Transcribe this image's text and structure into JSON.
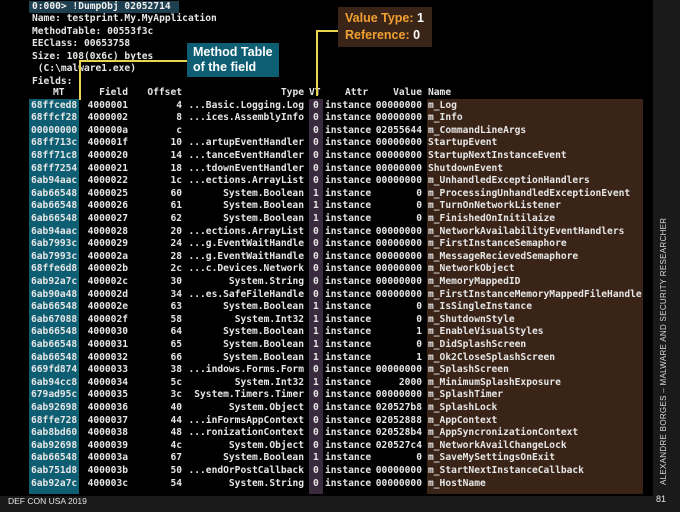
{
  "header": {
    "command": "0:000> !DumpObj 02052714",
    "name": "Name: testprint.My.MyApplication",
    "method_table": "MethodTable: 00553f3c",
    "ee_class": "EEClass: 00653758",
    "size": "Size: 108(0x6c) bytes",
    "file": " (C:\\malware1.exe)",
    "fields_label": "Fields:"
  },
  "callouts": {
    "method_table_line1": "Method Table",
    "method_table_line2": "of the field",
    "value_type_label": "Value Type:",
    "value_type_value": "1",
    "reference_label": "Reference:",
    "reference_value": "0"
  },
  "table": {
    "headers": {
      "mt": "MT",
      "field": "Field",
      "offset": "Offset",
      "type": "Type",
      "vt": "VT",
      "attr": "Attr",
      "value": "Value",
      "name": "Name"
    },
    "rows": [
      {
        "mt": "68ffced8",
        "field": "4000001",
        "offset": "4",
        "type": "...Basic.Logging.Log",
        "vt": "0",
        "attr": "instance",
        "value": "00000000",
        "name": "m_Log"
      },
      {
        "mt": "68ffcf28",
        "field": "4000002",
        "offset": "8",
        "type": "...ices.AssemblyInfo",
        "vt": "0",
        "attr": "instance",
        "value": "00000000",
        "name": "m_Info"
      },
      {
        "mt": "00000000",
        "field": "400000a",
        "offset": "c",
        "type": "",
        "vt": "0",
        "attr": "instance",
        "value": "02055644",
        "name": "m_CommandLineArgs"
      },
      {
        "mt": "68ff713c",
        "field": "400001f",
        "offset": "10",
        "type": "...artupEventHandler",
        "vt": "0",
        "attr": "instance",
        "value": "00000000",
        "name": "StartupEvent"
      },
      {
        "mt": "68ff71c8",
        "field": "4000020",
        "offset": "14",
        "type": "...tanceEventHandler",
        "vt": "0",
        "attr": "instance",
        "value": "00000000",
        "name": "StartupNextInstanceEvent"
      },
      {
        "mt": "68ff7254",
        "field": "4000021",
        "offset": "18",
        "type": "...tdownEventHandler",
        "vt": "0",
        "attr": "instance",
        "value": "00000000",
        "name": "ShutdownEvent"
      },
      {
        "mt": "6ab94aac",
        "field": "4000022",
        "offset": "1c",
        "type": "...ections.ArrayList",
        "vt": "0",
        "attr": "instance",
        "value": "00000000",
        "name": "m_UnhandledExceptionHandlers"
      },
      {
        "mt": "6ab66548",
        "field": "4000025",
        "offset": "60",
        "type": "System.Boolean",
        "vt": "1",
        "attr": "instance",
        "value": "0",
        "name": "m_ProcessingUnhandledExceptionEvent"
      },
      {
        "mt": "6ab66548",
        "field": "4000026",
        "offset": "61",
        "type": "System.Boolean",
        "vt": "1",
        "attr": "instance",
        "value": "0",
        "name": "m_TurnOnNetworkListener"
      },
      {
        "mt": "6ab66548",
        "field": "4000027",
        "offset": "62",
        "type": "System.Boolean",
        "vt": "1",
        "attr": "instance",
        "value": "0",
        "name": "m_FinishedOnInitilaize"
      },
      {
        "mt": "6ab94aac",
        "field": "4000028",
        "offset": "20",
        "type": "...ections.ArrayList",
        "vt": "0",
        "attr": "instance",
        "value": "00000000",
        "name": "m_NetworkAvailabilityEventHandlers"
      },
      {
        "mt": "6ab7993c",
        "field": "4000029",
        "offset": "24",
        "type": "...g.EventWaitHandle",
        "vt": "0",
        "attr": "instance",
        "value": "00000000",
        "name": "m_FirstInstanceSemaphore"
      },
      {
        "mt": "6ab7993c",
        "field": "400002a",
        "offset": "28",
        "type": "...g.EventWaitHandle",
        "vt": "0",
        "attr": "instance",
        "value": "00000000",
        "name": "m_MessageRecievedSemaphore"
      },
      {
        "mt": "68ffe6d8",
        "field": "400002b",
        "offset": "2c",
        "type": "...c.Devices.Network",
        "vt": "0",
        "attr": "instance",
        "value": "00000000",
        "name": "m_NetworkObject"
      },
      {
        "mt": "6ab92a7c",
        "field": "400002c",
        "offset": "30",
        "type": "System.String",
        "vt": "0",
        "attr": "instance",
        "value": "00000000",
        "name": "m_MemoryMappedID"
      },
      {
        "mt": "6ab90a48",
        "field": "400002d",
        "offset": "34",
        "type": "...es.SafeFileHandle",
        "vt": "0",
        "attr": "instance",
        "value": "00000000",
        "name": "m_FirstInstanceMemoryMappedFileHandle"
      },
      {
        "mt": "6ab66548",
        "field": "400002e",
        "offset": "63",
        "type": "System.Boolean",
        "vt": "1",
        "attr": "instance",
        "value": "0",
        "name": "m_IsSingleInstance"
      },
      {
        "mt": "6ab67088",
        "field": "400002f",
        "offset": "58",
        "type": "System.Int32",
        "vt": "1",
        "attr": "instance",
        "value": "0",
        "name": "m_ShutdownStyle"
      },
      {
        "mt": "6ab66548",
        "field": "4000030",
        "offset": "64",
        "type": "System.Boolean",
        "vt": "1",
        "attr": "instance",
        "value": "1",
        "name": "m_EnableVisualStyles"
      },
      {
        "mt": "6ab66548",
        "field": "4000031",
        "offset": "65",
        "type": "System.Boolean",
        "vt": "1",
        "attr": "instance",
        "value": "0",
        "name": "m_DidSplashScreen"
      },
      {
        "mt": "6ab66548",
        "field": "4000032",
        "offset": "66",
        "type": "System.Boolean",
        "vt": "1",
        "attr": "instance",
        "value": "1",
        "name": "m_Ok2CloseSplashScreen"
      },
      {
        "mt": "669fd874",
        "field": "4000033",
        "offset": "38",
        "type": "...indows.Forms.Form",
        "vt": "0",
        "attr": "instance",
        "value": "00000000",
        "name": "m_SplashScreen"
      },
      {
        "mt": "6ab94cc8",
        "field": "4000034",
        "offset": "5c",
        "type": "System.Int32",
        "vt": "1",
        "attr": "instance",
        "value": "2000",
        "name": "m_MinimumSplashExposure"
      },
      {
        "mt": "679ad95c",
        "field": "4000035",
        "offset": "3c",
        "type": "System.Timers.Timer",
        "vt": "0",
        "attr": "instance",
        "value": "00000000",
        "name": "m_SplashTimer"
      },
      {
        "mt": "6ab92698",
        "field": "4000036",
        "offset": "40",
        "type": "System.Object",
        "vt": "0",
        "attr": "instance",
        "value": "020527b8",
        "name": "m_SplashLock"
      },
      {
        "mt": "68ffe728",
        "field": "4000037",
        "offset": "44",
        "type": "...inFormsAppContext",
        "vt": "0",
        "attr": "instance",
        "value": "02052888",
        "name": "m_AppContext"
      },
      {
        "mt": "6ab8bd60",
        "field": "4000038",
        "offset": "48",
        "type": "...ronizationContext",
        "vt": "0",
        "attr": "instance",
        "value": "020528b4",
        "name": "m_AppSyncronizationContext"
      },
      {
        "mt": "6ab92698",
        "field": "4000039",
        "offset": "4c",
        "type": "System.Object",
        "vt": "0",
        "attr": "instance",
        "value": "020527c4",
        "name": "m_NetworkAvailChangeLock"
      },
      {
        "mt": "6ab66548",
        "field": "400003a",
        "offset": "67",
        "type": "System.Boolean",
        "vt": "1",
        "attr": "instance",
        "value": "0",
        "name": "m_SaveMySettingsOnExit"
      },
      {
        "mt": "6ab751d8",
        "field": "400003b",
        "offset": "50",
        "type": "...endOrPostCallback",
        "vt": "0",
        "attr": "instance",
        "value": "00000000",
        "name": "m_StartNextInstanceCallback"
      },
      {
        "mt": "6ab92a7c",
        "field": "400003c",
        "offset": "54",
        "type": "System.String",
        "vt": "0",
        "attr": "instance",
        "value": "00000000",
        "name": "m_HostName"
      }
    ]
  },
  "footer": {
    "left": "DEF CON USA 2019",
    "page": "81",
    "side": "ALEXANDRE BORGES – MALWARE AND SECURITY RESEARCHER"
  },
  "colors": {
    "mt_column": "#0e5e73",
    "vt_column": "#3a2a3d",
    "name_column": "#3a2418",
    "callout_text_orange": "#f0a030",
    "leader_line": "#e8d44d"
  }
}
